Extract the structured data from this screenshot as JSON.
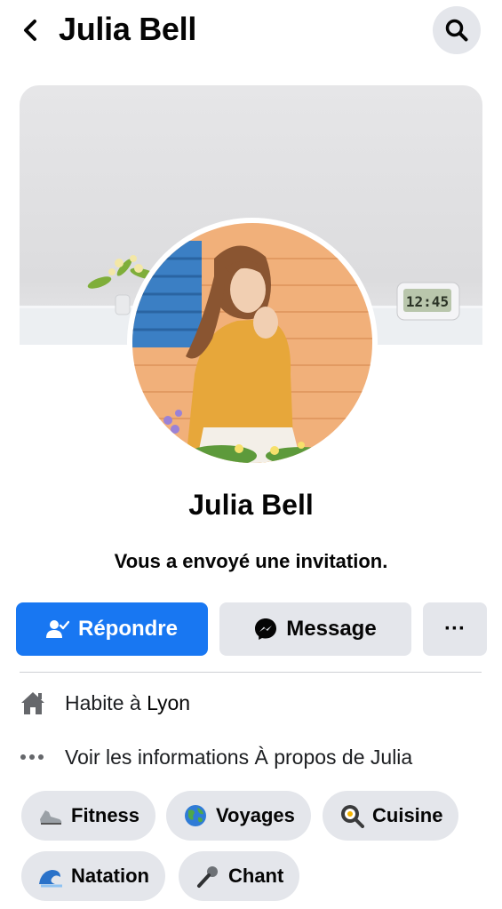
{
  "header": {
    "title": "Julia Bell",
    "back_icon": "chevron-left-icon",
    "search_icon": "search-icon"
  },
  "profile": {
    "name": "Julia Bell",
    "status": "Vous a envoyé une invitation.",
    "clock_text": "12:45"
  },
  "actions": {
    "respond_label": "Répondre",
    "message_label": "Message",
    "more_label": "···",
    "respond_color": "#1877f2"
  },
  "info": {
    "home_prefix": "Habite à ",
    "home_city": "Lyon",
    "about_label": "Voir les informations À propos de Julia"
  },
  "interests": [
    {
      "label": "Fitness",
      "icon": "sneaker-icon"
    },
    {
      "label": "Voyages",
      "icon": "globe-icon"
    },
    {
      "label": "Cuisine",
      "icon": "frying-pan-icon"
    },
    {
      "label": "Natation",
      "icon": "wave-icon"
    },
    {
      "label": "Chant",
      "icon": "microphone-icon"
    }
  ]
}
